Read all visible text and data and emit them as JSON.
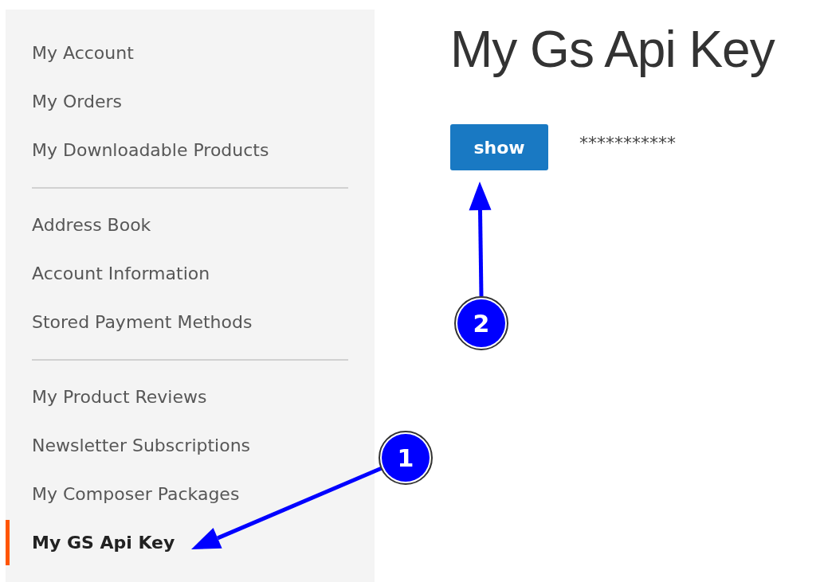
{
  "sidebar": {
    "groups": [
      {
        "items": [
          {
            "label": "My Account",
            "selected": false
          },
          {
            "label": "My Orders",
            "selected": false
          },
          {
            "label": "My Downloadable Products",
            "selected": false
          }
        ]
      },
      {
        "items": [
          {
            "label": "Address Book",
            "selected": false
          },
          {
            "label": "Account Information",
            "selected": false
          },
          {
            "label": "Stored Payment Methods",
            "selected": false
          }
        ]
      },
      {
        "items": [
          {
            "label": "My Product Reviews",
            "selected": false
          },
          {
            "label": "Newsletter Subscriptions",
            "selected": false
          },
          {
            "label": "My Composer Packages",
            "selected": false
          },
          {
            "label": "My GS Api Key",
            "selected": true
          }
        ]
      }
    ]
  },
  "page_title": "My Gs Api Key",
  "key_panel": {
    "button": "show",
    "masked_key": "***********"
  },
  "annotations": [
    {
      "label": "1"
    },
    {
      "label": "2"
    }
  ]
}
